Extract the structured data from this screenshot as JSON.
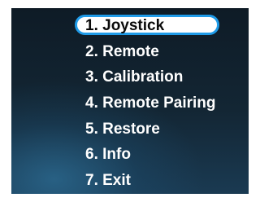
{
  "menu": {
    "items": [
      {
        "label": "1. Joystick",
        "selected": true
      },
      {
        "label": "2. Remote",
        "selected": false
      },
      {
        "label": "3. Calibration",
        "selected": false
      },
      {
        "label": "4. Remote Pairing",
        "selected": false
      },
      {
        "label": "5. Restore",
        "selected": false
      },
      {
        "label": "6. Info",
        "selected": false
      },
      {
        "label": "7. Exit",
        "selected": false
      }
    ]
  },
  "colors": {
    "highlight_border": "#1f9be8",
    "highlight_fill": "#ffffff",
    "text": "#ffffff",
    "selected_text": "#0a0a0a"
  }
}
